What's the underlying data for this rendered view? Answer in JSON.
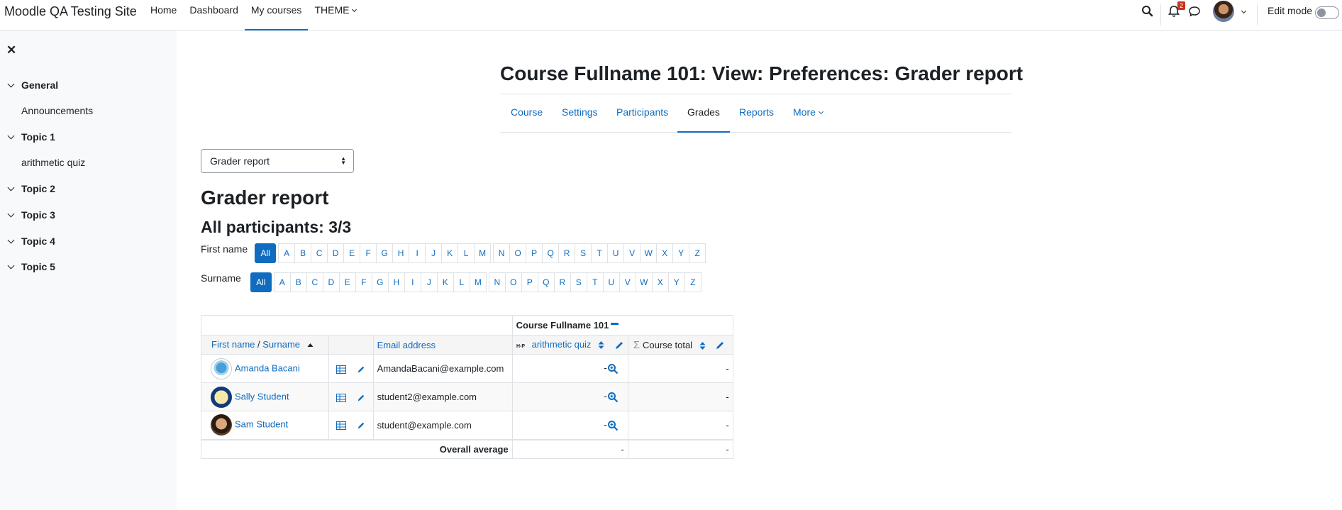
{
  "site": {
    "name": "Moodle QA Testing Site"
  },
  "nav": {
    "items": [
      "Home",
      "Dashboard",
      "My courses",
      "THEME"
    ],
    "notification_count": "2",
    "edit_mode_label": "Edit mode"
  },
  "drawer": {
    "sections": [
      {
        "title": "General",
        "activity": "Announcements"
      },
      {
        "title": "Topic 1",
        "activity": "arithmetic quiz"
      },
      {
        "title": "Topic 2"
      },
      {
        "title": "Topic 3"
      },
      {
        "title": "Topic 4"
      },
      {
        "title": "Topic 5"
      }
    ]
  },
  "page": {
    "title": "Course Fullname 101: View: Preferences: Grader report",
    "secondary_nav": [
      "Course",
      "Settings",
      "Participants",
      "Grades",
      "Reports",
      "More"
    ],
    "report_selector": "Grader report",
    "heading": "Grader report",
    "participants": "All participants: 3/3"
  },
  "initials": {
    "first_label": "First name",
    "surname_label": "Surname",
    "all": "All",
    "group1": [
      "A",
      "B",
      "C",
      "D",
      "E",
      "F",
      "G",
      "H",
      "I",
      "J",
      "K",
      "L",
      "M"
    ],
    "group2": [
      "N",
      "O",
      "P",
      "Q",
      "R",
      "S",
      "T",
      "U",
      "V",
      "W",
      "X",
      "Y",
      "Z"
    ]
  },
  "table": {
    "course_header": "Course Fullname 101",
    "col_first": "First name",
    "col_sep": " / ",
    "col_surname": "Surname",
    "col_email": "Email address",
    "col_quiz": "arithmetic quiz",
    "col_total": "Course total",
    "rows": [
      {
        "name": "Amanda Bacani",
        "email": "AmandaBacani@example.com",
        "quiz": "-",
        "total": "-"
      },
      {
        "name": "Sally Student",
        "email": "student2@example.com",
        "quiz": "-",
        "total": "-"
      },
      {
        "name": "Sam Student",
        "email": "student@example.com",
        "quiz": "-",
        "total": "-"
      }
    ],
    "avg_label": "Overall average",
    "avg_quiz": "-",
    "avg_total": "-"
  }
}
